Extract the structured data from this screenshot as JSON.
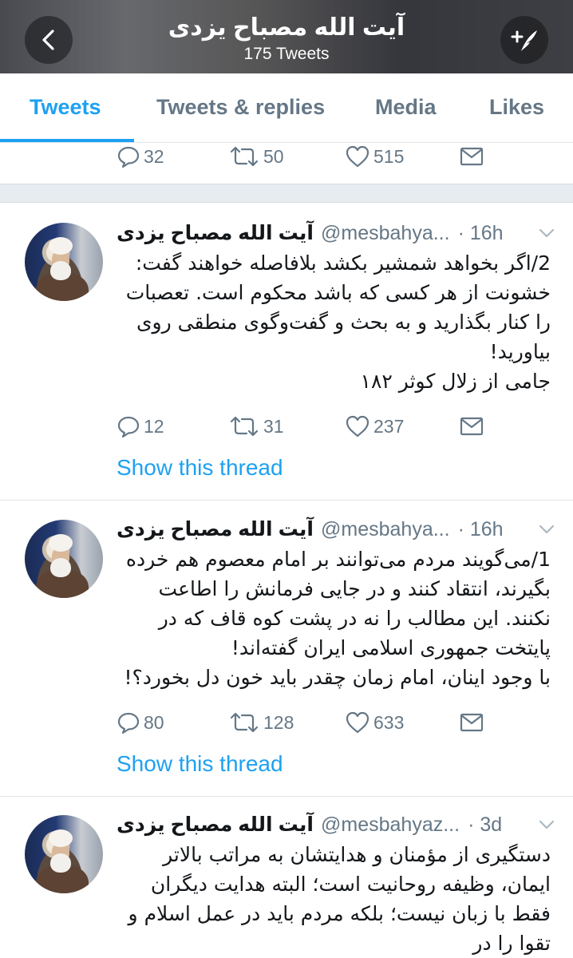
{
  "header": {
    "title": "آیت الله مصباح یزدی",
    "tweet_count": "175 Tweets",
    "back_icon": "chevron-left-icon",
    "compose_icon": "compose-tweet-icon"
  },
  "tabs": [
    {
      "label": "Tweets",
      "active": true
    },
    {
      "label": "Tweets & replies",
      "active": false
    },
    {
      "label": "Media",
      "active": false
    },
    {
      "label": "Likes",
      "active": false
    }
  ],
  "top_actions": {
    "replies": "32",
    "retweets": "50",
    "likes": "515"
  },
  "tweets": [
    {
      "name": "آیت الله مصباح یزدی",
      "handle": "@mesbahya...",
      "time": "· 16h",
      "text": "2/اگر بخواهد شمشیر بکشد بلافاصله خواهند گفت: خشونت از هر کسی که باشد محکوم است. تعصبات را کنار بگذارید و به بحث و گفت‌وگوی منطقی روی بیاورید!\nجامی از زلال کوثر ۱۸۲",
      "replies": "12",
      "retweets": "31",
      "likes": "237",
      "show_thread": "Show this thread"
    },
    {
      "name": "آیت الله مصباح یزدی",
      "handle": "@mesbahya...",
      "time": "· 16h",
      "text": "1/می‌گویند مردم می‌توانند بر امام معصوم هم خرده بگیرند، انتقاد کنند و در جایی فرمانش را اطاعت نکنند. این مطالب را نه در پشت کوه قاف که در پایتخت جمهوری اسلامی ایران گفته‌اند!\nبا وجود اینان، امام زمان چقدر باید خون دل بخورد؟!",
      "replies": "80",
      "retweets": "128",
      "likes": "633",
      "show_thread": "Show this thread"
    },
    {
      "name": "آیت الله مصباح یزدی",
      "handle": "@mesbahyaz...",
      "time": "· 3d",
      "text": "دستگیری از مؤمنان و هدایتشان به مراتب بالاتر ایمان، وظیفه روحانیت است؛ البته هدایت دیگران فقط با زبان نیست؛ بلکه مردم باید در عمل اسلام و تقوا را در"
    }
  ],
  "colors": {
    "accent": "#1da1f2",
    "muted": "#657786",
    "text": "#14171a"
  }
}
